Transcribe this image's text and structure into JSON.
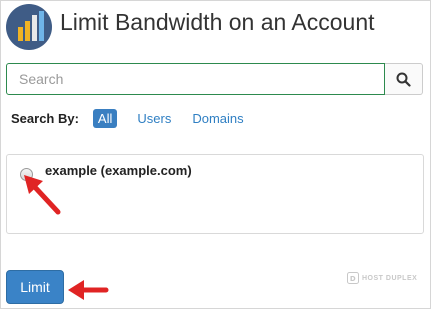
{
  "header": {
    "title": "Limit Bandwidth on an Account",
    "icon": "bandwidth-bars-icon"
  },
  "search": {
    "placeholder": "Search",
    "value": "",
    "button_icon": "search-icon"
  },
  "filters": {
    "label": "Search By:",
    "options": [
      {
        "label": "All",
        "active": true
      },
      {
        "label": "Users",
        "active": false
      },
      {
        "label": "Domains",
        "active": false
      }
    ]
  },
  "accounts": [
    {
      "label": "example (example.com)",
      "selected": false
    }
  ],
  "actions": {
    "limit_label": "Limit"
  },
  "watermark": {
    "text": "HOST DUPLEX"
  },
  "colors": {
    "primary": "#3a83c7",
    "search_border": "#2d8a4e",
    "annotation_arrow": "#e02424"
  }
}
